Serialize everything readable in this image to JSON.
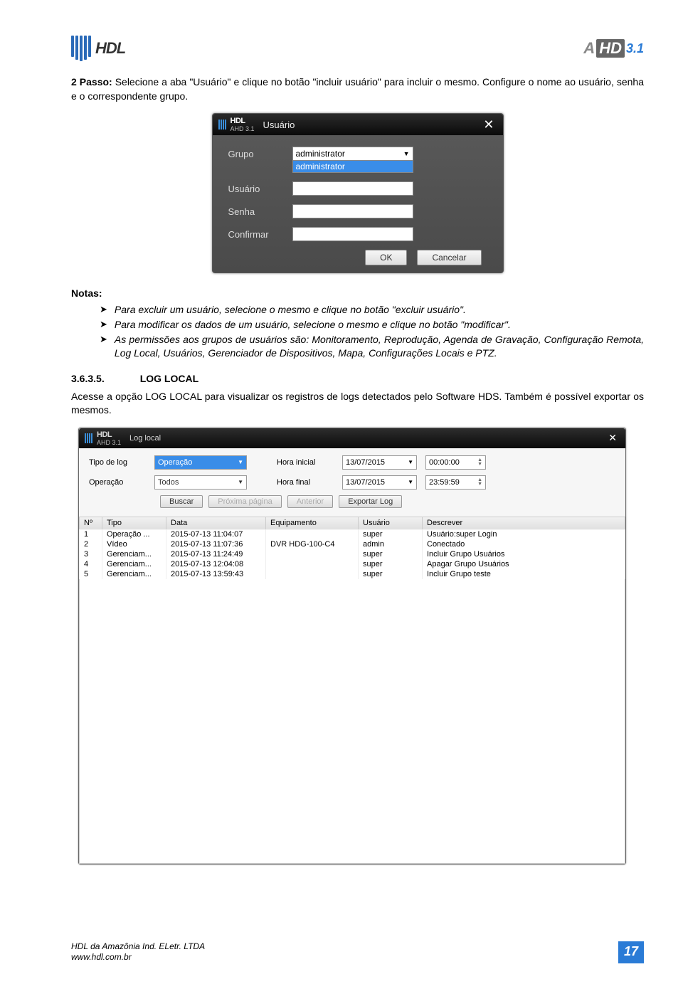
{
  "header": {
    "logo_text": "HDL",
    "logo_right_a": "A",
    "logo_right_hd": "HD",
    "logo_right_ver": "3.1"
  },
  "intro": {
    "prefix": "2 Passo:",
    "text_after_prefix": " Selecione a aba \"Usuário\" e clique no botão \"incluir usuário\" para incluir o mesmo. Configure o nome ao usuário, senha e o correspondente grupo."
  },
  "dialog": {
    "brand": "HDL",
    "subbrand": "AHD 3.1",
    "title": "Usuário",
    "close": "✕",
    "labels": {
      "grupo": "Grupo",
      "usuario": "Usuário",
      "senha": "Senha",
      "confirmar": "Confirmar"
    },
    "grupo_value": "administrator",
    "grupo_option": "administrator",
    "ok": "OK",
    "cancel": "Cancelar"
  },
  "notas": {
    "header": "Notas:",
    "items": [
      "Para excluir um usuário, selecione o mesmo e clique no botão \"excluir usuário\".",
      "Para modificar os dados de um usuário, selecione o mesmo e clique no botão \"modificar\".",
      "As permissões aos grupos de usuários são: Monitoramento, Reprodução, Agenda de Gravação, Configuração Remota, Log Local, Usuários, Gerenciador de Dispositivos, Mapa, Configurações Locais e PTZ."
    ]
  },
  "section": {
    "num": "3.6.3.5.",
    "title": "LOG LOCAL"
  },
  "section_text": "Acesse a opção LOG LOCAL para visualizar os registros de logs detectados pelo Software HDS. Também é possível exportar os mesmos.",
  "log": {
    "title": "Log local",
    "close": "✕",
    "labels": {
      "tipo": "Tipo de log",
      "operacao": "Operação",
      "hora_inicial": "Hora inicial",
      "hora_final": "Hora final"
    },
    "tipo_value": "Operação",
    "operacao_value": "Todos",
    "date1": "13/07/2015",
    "time1": "00:00:00",
    "date2": "13/07/2015",
    "time2": "23:59:59",
    "buttons": {
      "buscar": "Buscar",
      "proxima": "Próxima página",
      "anterior": "Anterior",
      "exportar": "Exportar Log"
    },
    "columns": [
      "Nº",
      "Tipo",
      "Data",
      "Equipamento",
      "Usuário",
      "Descrever"
    ],
    "rows": [
      {
        "n": "1",
        "tipo": "Operação ...",
        "data": "2015-07-13 11:04:07",
        "equip": "",
        "user": "super",
        "desc": "Usuário:super Login"
      },
      {
        "n": "2",
        "tipo": "Vídeo",
        "data": "2015-07-13 11:07:36",
        "equip": "DVR HDG-100-C4",
        "user": "admin",
        "desc": "Conectado"
      },
      {
        "n": "3",
        "tipo": "Gerenciam...",
        "data": "2015-07-13 11:24:49",
        "equip": "",
        "user": "super",
        "desc": "Incluir Grupo Usuários"
      },
      {
        "n": "4",
        "tipo": "Gerenciam...",
        "data": "2015-07-13 12:04:08",
        "equip": "",
        "user": "super",
        "desc": "Apagar Grupo Usuários"
      },
      {
        "n": "5",
        "tipo": "Gerenciam...",
        "data": "2015-07-13 13:59:43",
        "equip": "",
        "user": "super",
        "desc": "Incluir Grupo teste"
      }
    ]
  },
  "footer": {
    "line1": "HDL da Amazônia Ind. ELetr. LTDA",
    "line2": "www.hdl.com.br",
    "page": "17"
  }
}
